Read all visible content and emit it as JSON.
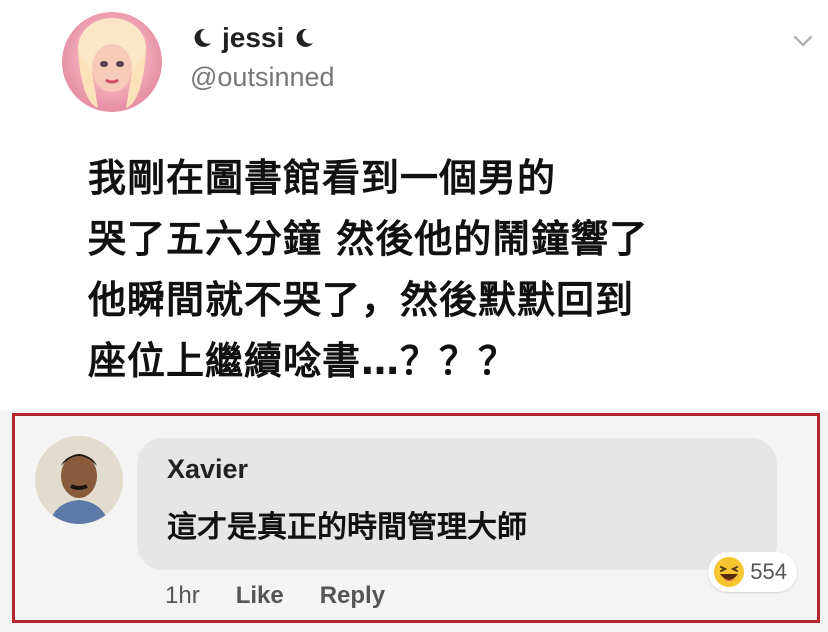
{
  "tweet": {
    "display_name": "jessi",
    "handle": "@outsinned",
    "lines": [
      "我剛在圖書館看到一個男的",
      "哭了五六分鐘 然後他的鬧鐘響了",
      "他瞬間就不哭了，然後默默回到",
      "座位上繼續唸書…？？？"
    ],
    "menu_icon": "chevron-down-icon",
    "name_icons": [
      "crescent-moon-icon",
      "crescent-moon-icon"
    ]
  },
  "comment": {
    "author": "Xavier",
    "text": "這才是真正的時間管理大師",
    "reaction_icon": "laughing-emoji-icon",
    "reaction_count": "554",
    "time": "1hr",
    "like_label": "Like",
    "reply_label": "Reply",
    "highlight_color": "#b5252e"
  }
}
